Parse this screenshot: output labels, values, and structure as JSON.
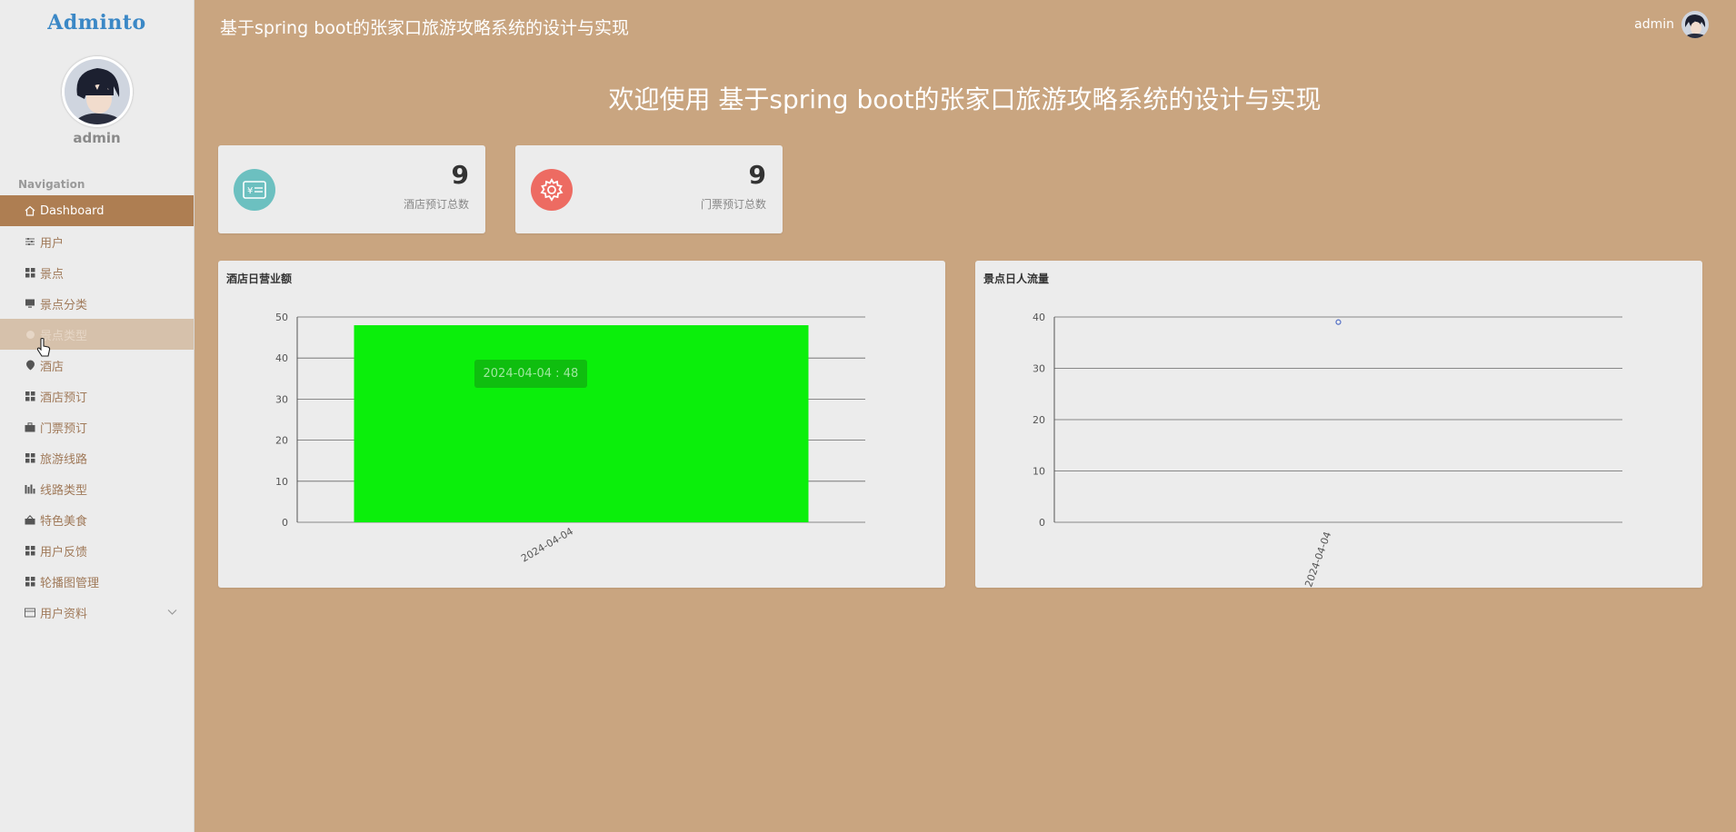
{
  "app": {
    "logo": "Adminto",
    "title": "基于spring boot的张家口旅游攻略系统的设计与实现",
    "welcome": "欢迎使用 基于spring boot的张家口旅游攻略系统的设计与实现"
  },
  "user": {
    "name": "admin"
  },
  "sidebar": {
    "heading": "Navigation",
    "items": [
      {
        "label": "Dashboard",
        "icon": "home-icon"
      },
      {
        "label": "用户",
        "icon": "sliders-icon"
      },
      {
        "label": "景点",
        "icon": "grid-icon"
      },
      {
        "label": "景点分类",
        "icon": "monitor-icon"
      },
      {
        "label": "景点类型",
        "icon": "circle-icon"
      },
      {
        "label": "酒店",
        "icon": "pin-icon"
      },
      {
        "label": "酒店预订",
        "icon": "grid-icon"
      },
      {
        "label": "门票预订",
        "icon": "briefcase-icon"
      },
      {
        "label": "旅游线路",
        "icon": "grid-icon"
      },
      {
        "label": "线路类型",
        "icon": "bar-icon"
      },
      {
        "label": "特色美食",
        "icon": "bag-icon"
      },
      {
        "label": "用户反馈",
        "icon": "grid-icon"
      },
      {
        "label": "轮播图管理",
        "icon": "grid-icon"
      },
      {
        "label": "用户资料",
        "icon": "card-icon"
      }
    ]
  },
  "stats": [
    {
      "value": "9",
      "label": "酒店预订总数",
      "icon": "id-card-icon",
      "color": "#6cc0c0"
    },
    {
      "value": "9",
      "label": "门票预订总数",
      "icon": "gear-icon",
      "color": "#ed6b62"
    }
  ],
  "colors": {
    "accent": "#ae7e52",
    "background": "#c9a580",
    "bar": "#0bef0b",
    "point": "#5470c6"
  },
  "chart_data": [
    {
      "type": "bar",
      "title": "酒店日营业额",
      "categories": [
        "2024-04-04"
      ],
      "values": [
        48
      ],
      "ylim": [
        0,
        50
      ],
      "yticks": [
        0,
        10,
        20,
        30,
        40,
        50
      ],
      "grid": true,
      "tooltip": "2024-04-04 : 48"
    },
    {
      "type": "scatter",
      "title": "景点日人流量",
      "categories": [
        "2024-04-04"
      ],
      "values": [
        39
      ],
      "ylim": [
        0,
        40
      ],
      "yticks": [
        0,
        10,
        20,
        30,
        40
      ],
      "grid": true
    }
  ]
}
